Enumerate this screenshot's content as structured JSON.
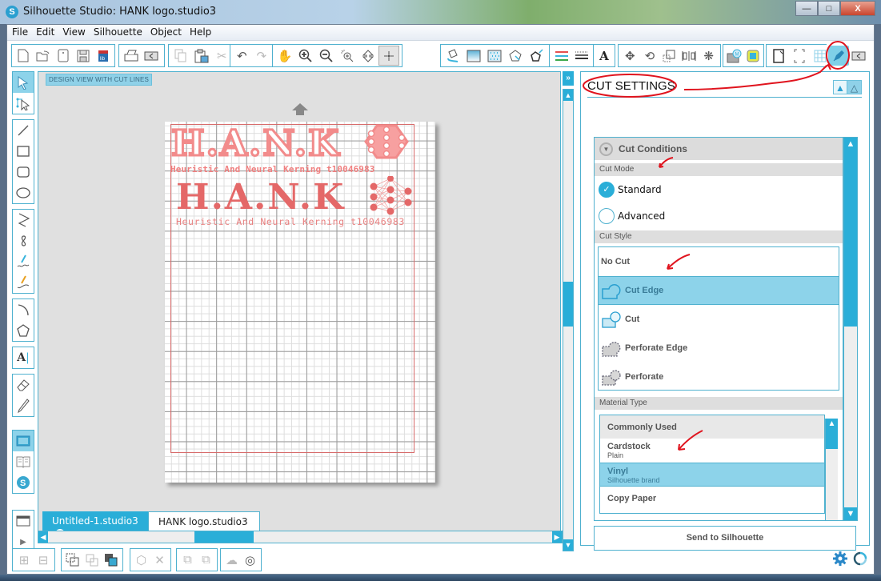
{
  "window": {
    "title": "Silhouette Studio: HANK logo.studio3",
    "minimize_label": "—",
    "maximize_label": "□",
    "close_label": "X"
  },
  "menu": [
    "File",
    "Edit",
    "View",
    "Silhouette",
    "Object",
    "Help"
  ],
  "toolbar": {
    "groups": [
      [
        "new-document-icon",
        "open-icon",
        "template-icon",
        "save-icon",
        "save-to-library-icon"
      ],
      [
        "print-icon",
        "send-to-cutter-icon"
      ],
      [
        "copy-icon",
        "paste-icon",
        "cut-scissors-icon"
      ],
      [
        "undo-icon",
        "redo-icon"
      ],
      [
        "pan-hand-icon",
        "zoom-in-icon",
        "zoom-out-icon",
        "zoom-select-icon",
        "drag-zoom-icon",
        "fit-to-page-icon"
      ],
      [
        "fill-color-icon",
        "gradient-fill-icon",
        "pattern-fill-icon",
        "line-color-icon",
        "line-style-icon"
      ],
      [
        "color-lines-icon",
        "line-weight-icon"
      ],
      [
        "text-style-icon"
      ],
      [
        "transform-icon",
        "rotate-icon",
        "scale-icon",
        "align-icon",
        "replicate-icon"
      ],
      [
        "library-icon",
        "offset-icon"
      ],
      [
        "page-setup-icon",
        "registration-marks-icon",
        "grid-icon"
      ],
      [
        "cut-settings-icon",
        "send-silhouette-icon"
      ]
    ]
  },
  "left_tools": {
    "groups": [
      [
        "select-arrow-icon",
        "edit-points-icon"
      ],
      [
        "line-tool-icon",
        "rectangle-tool-icon",
        "rounded-rectangle-tool-icon",
        "ellipse-tool-icon"
      ],
      [
        "polygon-tool-icon",
        "curve-tool-icon",
        "freehand-tool-icon",
        "smooth-freehand-tool-icon"
      ],
      [
        "arc-tool-icon",
        "regular-polygon-tool-icon"
      ],
      [
        "text-tool-icon"
      ],
      [
        "eraser-tool-icon",
        "knife-tool-icon"
      ],
      [
        "design-view-icon",
        "library-view-icon",
        "silhouette-store-icon"
      ],
      [
        "window-icon",
        "expand-icon"
      ]
    ]
  },
  "canvas": {
    "view_badge": "DESIGN VIEW WITH CUT LINES",
    "logo_outline_text": "H.A.N.K",
    "logo_outline_tagline": "Heuristic And Neural Kerning t10046983",
    "logo_solid_text": "H.A.N.K",
    "logo_solid_tagline": "Heuristic And Neural Kerning t10046983"
  },
  "tabs": [
    {
      "label": "Untitled-1.studio3",
      "close": "x",
      "active": false
    },
    {
      "label": "HANK logo.studio3",
      "close": "x",
      "active": true
    }
  ],
  "panel": {
    "title": "CUT SETTINGS",
    "collapse_btn": "»",
    "cut_conditions": "Cut Conditions",
    "cut_mode_label": "Cut Mode",
    "cut_modes": [
      {
        "label": "Standard",
        "selected": true
      },
      {
        "label": "Advanced",
        "selected": false
      }
    ],
    "cut_style_label": "Cut Style",
    "cut_styles": [
      {
        "label": "No Cut",
        "icon": "",
        "selected": false
      },
      {
        "label": "Cut Edge",
        "icon": "cut-edge-icon",
        "selected": true
      },
      {
        "label": "Cut",
        "icon": "cut-icon",
        "selected": false
      },
      {
        "label": "Perforate Edge",
        "icon": "perforate-edge-icon",
        "selected": false
      },
      {
        "label": "Perforate",
        "icon": "perforate-icon",
        "selected": false
      }
    ],
    "material_type_label": "Material Type",
    "material_group": "Commonly Used",
    "materials": [
      {
        "name": "Cardstock",
        "desc": "Plain",
        "selected": false
      },
      {
        "name": "Vinyl",
        "desc": "Silhouette brand",
        "selected": true
      },
      {
        "name": "Copy Paper",
        "desc": "",
        "selected": false
      }
    ],
    "send_button": "Send to Silhouette"
  },
  "colors": {
    "accent": "#2aaed8",
    "selection": "#8dd3ea",
    "border": "#4fb1cf",
    "cut_line": "#d86b6b",
    "logo": "#e46868",
    "annotation": "#e0141e"
  }
}
